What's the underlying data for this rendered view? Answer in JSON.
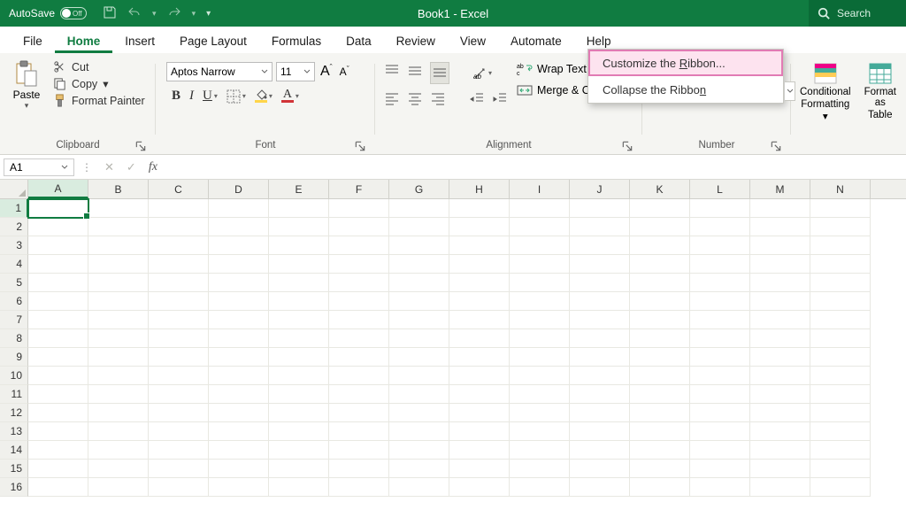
{
  "titlebar": {
    "autosave_label": "AutoSave",
    "autosave_state": "Off",
    "doc_title": "Book1  -  Excel",
    "search_placeholder": "Search"
  },
  "tabs": [
    "File",
    "Home",
    "Insert",
    "Page Layout",
    "Formulas",
    "Data",
    "Review",
    "View",
    "Automate",
    "Help"
  ],
  "active_tab": "Home",
  "ribbon": {
    "clipboard": {
      "paste": "Paste",
      "cut": "Cut",
      "copy": "Copy",
      "format_painter": "Format Painter",
      "group_label": "Clipboard"
    },
    "font": {
      "name": "Aptos Narrow",
      "size": "11",
      "group_label": "Font"
    },
    "alignment": {
      "wrap": "Wrap Text",
      "merge": "Merge & Center",
      "group_label": "Alignment"
    },
    "number": {
      "group_label": "Number",
      "currency": "$",
      "percent": "%",
      "comma": ","
    },
    "styles": {
      "cond_fmt_l1": "Conditional",
      "cond_fmt_l2": "Formatting",
      "fmt_table_l1": "Format as",
      "fmt_table_l2": "Table"
    }
  },
  "context_menu": {
    "customize": "Customize the Ribbon...",
    "customize_ul_char": "R",
    "collapse": "Collapse the Ribbon",
    "collapse_ul_char": "n"
  },
  "formula_bar": {
    "name_box": "A1",
    "fx": "fx",
    "value": ""
  },
  "grid": {
    "columns": [
      "A",
      "B",
      "C",
      "D",
      "E",
      "F",
      "G",
      "H",
      "I",
      "J",
      "K",
      "L",
      "M",
      "N"
    ],
    "rows": [
      1,
      2,
      3,
      4,
      5,
      6,
      7,
      8,
      9,
      10,
      11,
      12,
      13,
      14,
      15,
      16
    ],
    "active_cell": "A1"
  },
  "colors": {
    "brand": "#107c41",
    "fill_highlight": "#ffd54a",
    "font_color": "#d13438"
  }
}
